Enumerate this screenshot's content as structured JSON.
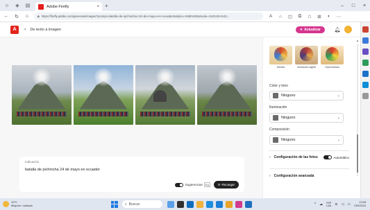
{
  "browser": {
    "tab_title": "Adobe Firefly",
    "url": "https://firefly.adobe.com/generate/images?prompt=batalla+de+pichincha+24+de+mayo+en+ecuador&styles=%5B%5D&mode=%22USA%22..."
  },
  "header": {
    "back_label": "De texto a imagen",
    "update_label": "Actualizar"
  },
  "prompt": {
    "label": "Indicación",
    "text": "batalla de pichincha 24 de mayo en ecuador",
    "suggestions_label": "Sugerencias",
    "lang_flag": "Eg",
    "generate_label": "Recargar"
  },
  "panel": {
    "styles": [
      {
        "label": "Medios",
        "icon": "balloon-thumbnail"
      },
      {
        "label": "Ilustración digital",
        "icon": "balloon-thumbnail"
      },
      {
        "label": "Hiperrealista",
        "icon": "balloon-thumbnail"
      }
    ],
    "color_label": "Color y tono",
    "color_value": "Ninguno",
    "lighting_label": "Iluminación",
    "lighting_value": "Ninguno",
    "composition_label": "Composición",
    "composition_value": "Ninguno",
    "photo_settings_label": "Configuración de las fotos",
    "photo_auto_label": "Automático",
    "advanced_label": "Configuración avanzada"
  },
  "taskbar": {
    "weather_temp": "19°C",
    "weather_desc": "Mayorm. nublado",
    "search_placeholder": "Buscar",
    "lang_top": "ESP",
    "lang_bottom": "LAA",
    "time": "13:28",
    "date": "23/5/2024"
  },
  "colors": {
    "accent": "#d5358f",
    "brand": "#e2241b"
  }
}
